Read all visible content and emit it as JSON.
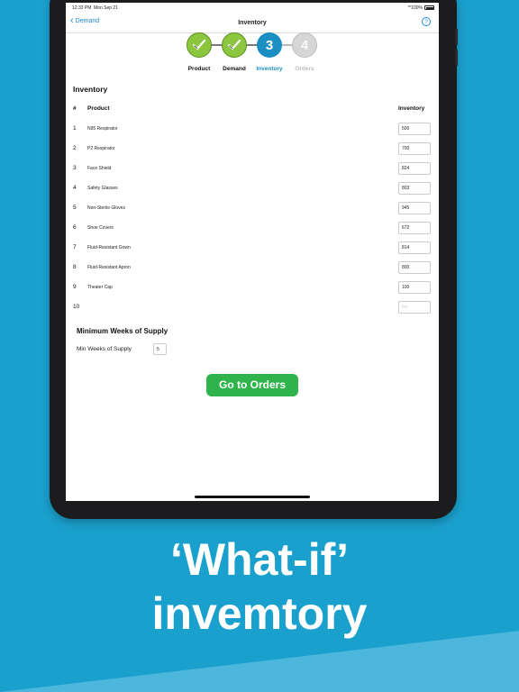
{
  "status_bar": {
    "time": "12:33 PM",
    "date": "Mon Sep 21",
    "battery": "100%"
  },
  "nav": {
    "back_label": "Demand",
    "title": "Inventory",
    "help_icon": "?"
  },
  "steps": [
    {
      "label": "Product",
      "state": "done",
      "number": ""
    },
    {
      "label": "Demand",
      "state": "done",
      "number": ""
    },
    {
      "label": "Inventory",
      "state": "active",
      "number": "3"
    },
    {
      "label": "Orders",
      "state": "todo",
      "number": "4"
    }
  ],
  "section": {
    "title": "Inventory"
  },
  "table": {
    "headers": {
      "num": "#",
      "product": "Product",
      "inventory": "Inventory"
    },
    "rows": [
      {
        "num": "1",
        "product": "N95 Respirator",
        "inventory": "500"
      },
      {
        "num": "2",
        "product": "P2 Respirator",
        "inventory": "700"
      },
      {
        "num": "3",
        "product": "Face Shield",
        "inventory": "824"
      },
      {
        "num": "4",
        "product": "Safety Glasses",
        "inventory": "803"
      },
      {
        "num": "5",
        "product": "Non-Sterile Gloves",
        "inventory": "945"
      },
      {
        "num": "6",
        "product": "Shoe Covers",
        "inventory": "672"
      },
      {
        "num": "7",
        "product": "Fluid-Resistant Gown",
        "inventory": "814"
      },
      {
        "num": "8",
        "product": "Fluid-Resistant Apron",
        "inventory": "800"
      },
      {
        "num": "9",
        "product": "Theater Cap",
        "inventory": "100"
      },
      {
        "num": "10",
        "product": "",
        "inventory": "",
        "placeholder": "Inv"
      }
    ]
  },
  "min_weeks": {
    "title": "Minimum Weeks of Supply",
    "label": "Min Weeks of Supply",
    "value": "5"
  },
  "button": {
    "label": "Go to Orders"
  },
  "caption": {
    "line1": "‘What-if’",
    "line2": "invemtory"
  },
  "colors": {
    "background": "#1aa0cd",
    "step_done": "#8cc63e",
    "step_active": "#1b8fc2",
    "button": "#2eb44a",
    "link": "#1e8ad6"
  }
}
